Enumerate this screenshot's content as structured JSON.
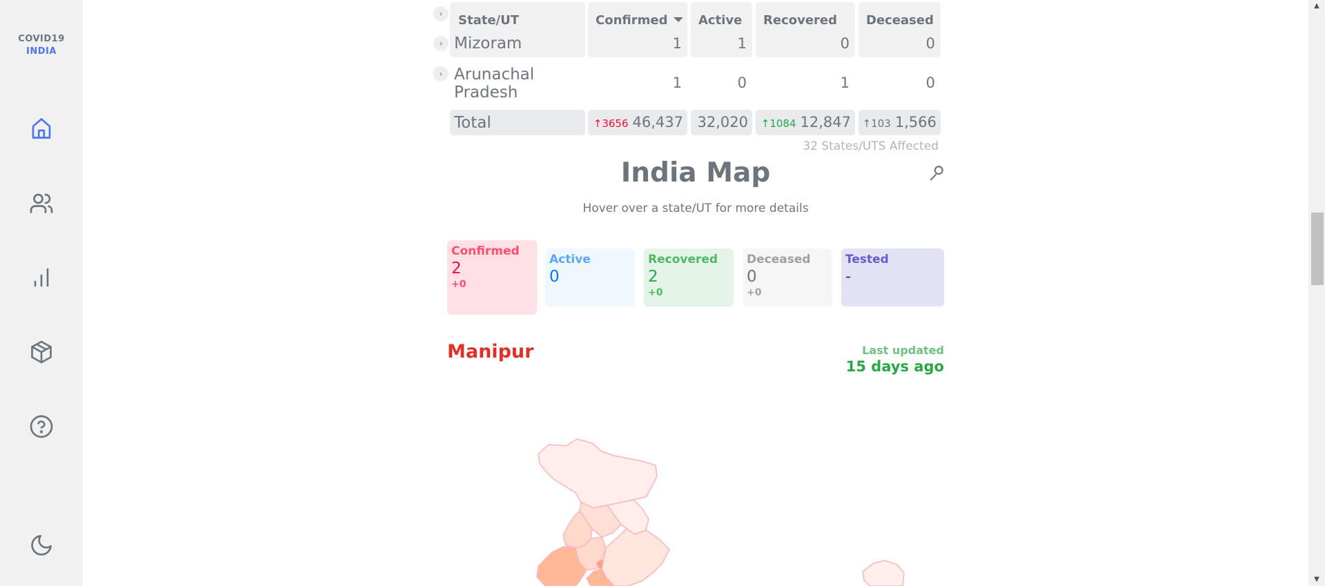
{
  "brand": {
    "line1": "COVID19",
    "line2": "INDIA"
  },
  "nav": [
    "home-icon",
    "users-icon",
    "bar-chart-icon",
    "package-icon",
    "help-icon",
    "moon-icon"
  ],
  "table": {
    "headers": {
      "state": "State/UT",
      "confirmed": "Confirmed",
      "active": "Active",
      "recovered": "Recovered",
      "deceased": "Deceased"
    },
    "rows": [
      {
        "state": "Mizoram",
        "confirmed": "1",
        "active": "1",
        "recovered": "0",
        "deceased": "0"
      },
      {
        "state_line1": "Arunachal",
        "state_line2": "Pradesh",
        "confirmed": "1",
        "active": "0",
        "recovered": "1",
        "deceased": "0"
      }
    ],
    "total": {
      "label": "Total",
      "confirmed_delta": "↑3656",
      "confirmed": "46,437",
      "active": "32,020",
      "recovered_delta": "↑1084",
      "recovered": "12,847",
      "deceased_delta": "↑103",
      "deceased": "1,566"
    },
    "affected": "32 States/UTS Affected"
  },
  "map": {
    "title": "India Map",
    "subtitle": "Hover over a state/UT for more details",
    "stats": {
      "confirmed": {
        "label": "Confirmed",
        "value": "2",
        "delta": "+0"
      },
      "active": {
        "label": "Active",
        "value": "0"
      },
      "recovered": {
        "label": "Recovered",
        "value": "2",
        "delta": "+0"
      },
      "deceased": {
        "label": "Deceased",
        "value": "0",
        "delta": "+0"
      },
      "tested": {
        "label": "Tested",
        "value": "-"
      }
    },
    "region": "Manipur",
    "last_updated_label": "Last updated",
    "last_updated_value": "15 days ago"
  }
}
